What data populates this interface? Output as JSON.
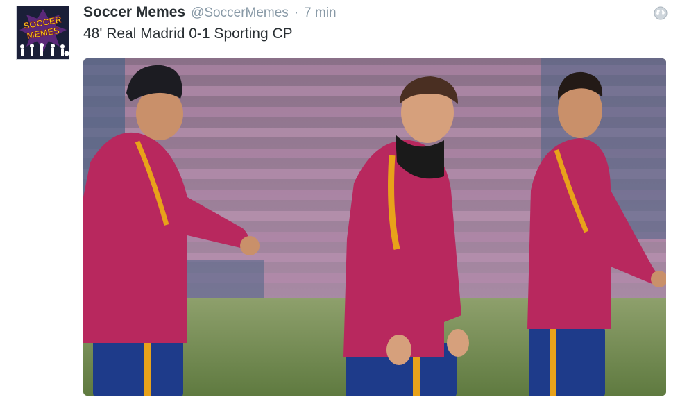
{
  "tweet": {
    "author_name": "Soccer Memes",
    "handle": "@SoccerMemes",
    "separator": "·",
    "time": "7 min",
    "text": "48' Real Madrid 0-1 Sporting CP"
  },
  "avatar": {
    "logo_line1": "SOCCER",
    "logo_line2": "MEMES",
    "bg_color": "#1a1f38",
    "logo_color": "#f7d21e"
  },
  "icons": {
    "globe": "globe-icon"
  },
  "media": {
    "description_colors": {
      "kit": "#b8285e",
      "stripe": "#e8a21a",
      "shorts": "#1e3b8a",
      "pitch": "#6f8a4d",
      "stands": "#9e6f8e"
    }
  }
}
